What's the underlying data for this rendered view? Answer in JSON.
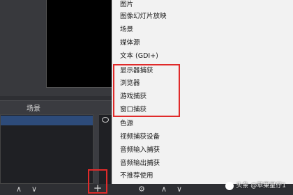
{
  "menu": {
    "items": [
      "图片",
      "图像幻灯片放映",
      "场景",
      "媒体源",
      "文本 (GDI+)",
      "显示器捕获",
      "浏览器",
      "游戏捕获",
      "窗口捕获",
      "色源",
      "视频捕获设备",
      "音频输入捕获",
      "音频输出捕获",
      "不推荐使用"
    ]
  },
  "scene_panel": {
    "title": "场景"
  },
  "controls": {
    "up_label": "∧",
    "down_label": "∨",
    "add_label": "+",
    "settings_label": "⚙",
    "minus_label": "−"
  },
  "watermark": {
    "text": "头条 @苹果星仔1"
  },
  "colors": {
    "highlight": "#e02a2a",
    "menu_bg": "#f2f2f2",
    "dark_bg": "#2e2f33"
  }
}
